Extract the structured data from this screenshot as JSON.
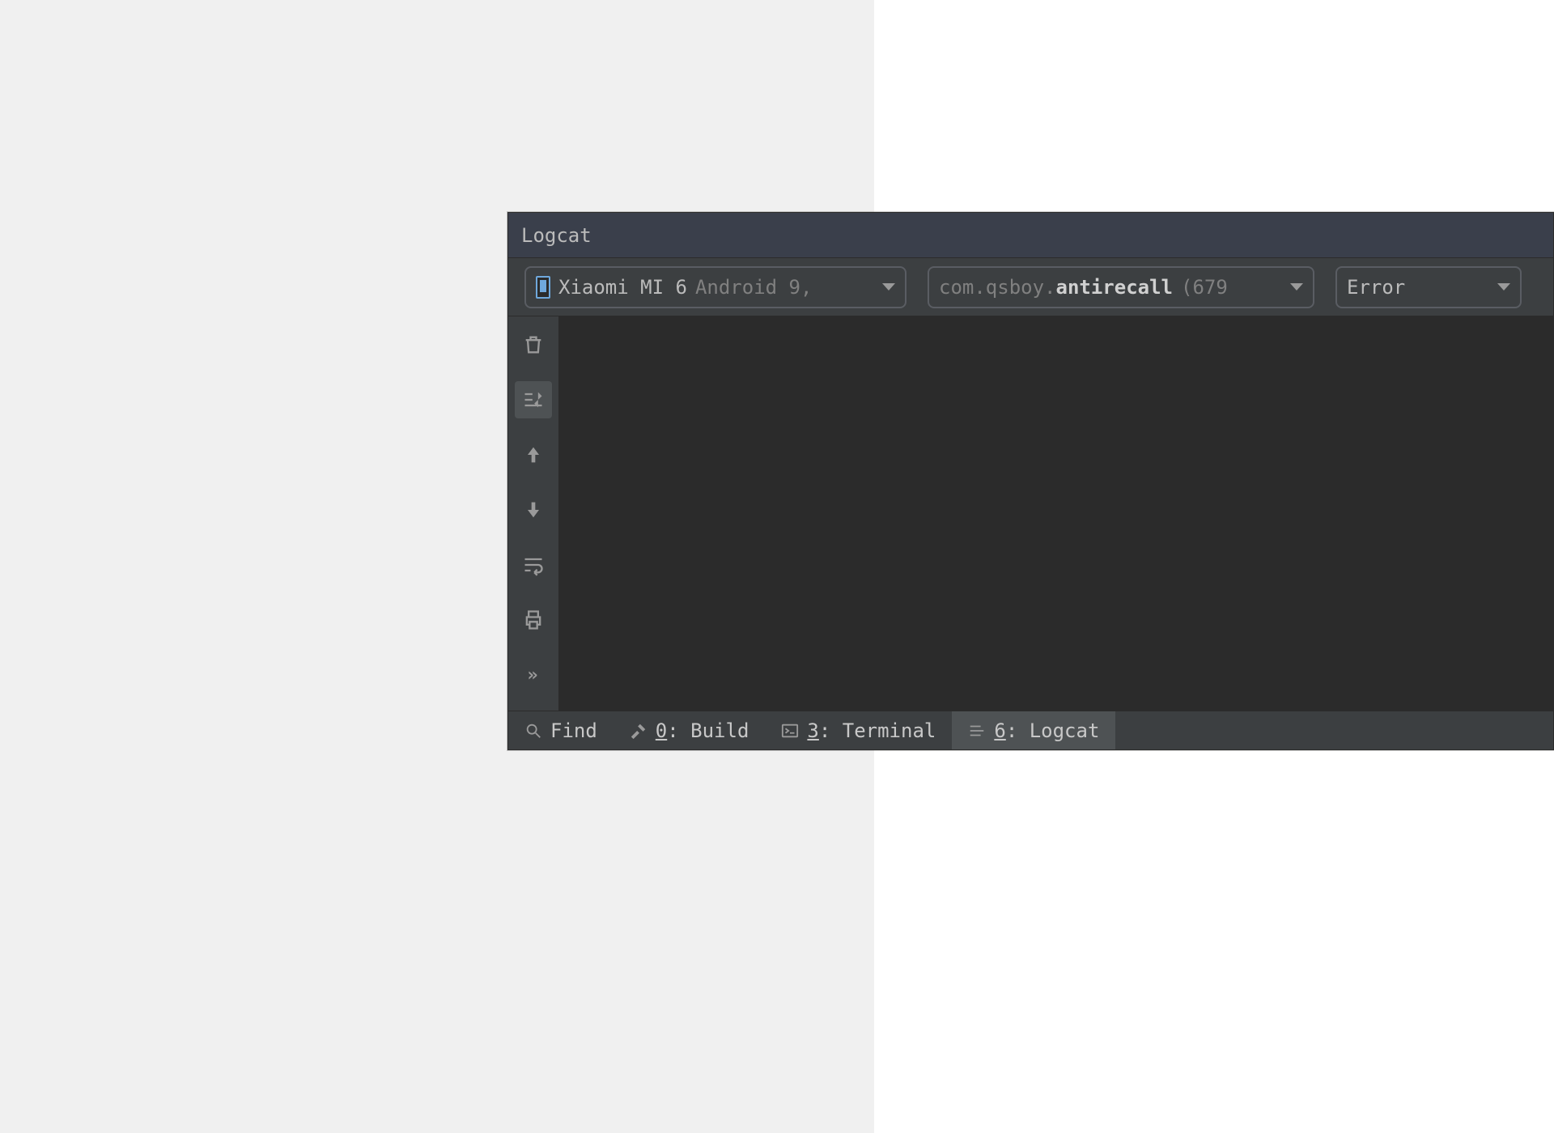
{
  "panel": {
    "title": "Logcat"
  },
  "filters": {
    "device": {
      "name": "Xiaomi MI 6",
      "os": "Android 9,"
    },
    "process": {
      "prefix": "com.qsboy.",
      "bold": "antirecall",
      "pid": "(679"
    },
    "level": "Error"
  },
  "side_toolbar": {
    "trash": "Clear",
    "scroll_end": "Scroll to end",
    "up": "Up",
    "down": "Down",
    "wrap": "Soft-wrap",
    "print": "Print",
    "more": "»"
  },
  "bottom_tabs": {
    "find": "Find",
    "build": {
      "m": "0",
      "label": ": Build"
    },
    "terminal": {
      "m": "3",
      "label": ": Terminal"
    },
    "logcat": {
      "m": "6",
      "label": ": Logcat"
    }
  }
}
